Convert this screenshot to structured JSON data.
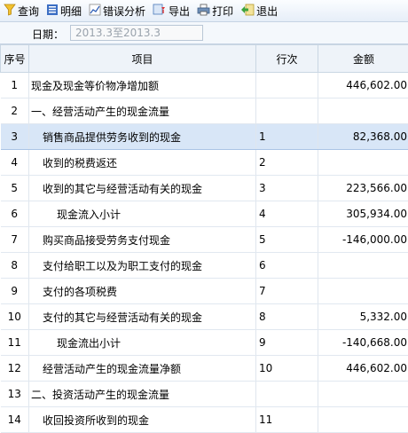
{
  "toolbar": {
    "query": "查询",
    "detail": "明细",
    "error_analysis": "错误分析",
    "export": "导出",
    "print": "打印",
    "exit": "退出"
  },
  "filter": {
    "date_label": "日期：",
    "date_value": "2013.3至2013.3"
  },
  "table": {
    "headers": [
      "序号",
      "项目",
      "行次",
      "金额"
    ],
    "rows": [
      {
        "no": "1",
        "item": "现金及现金等价物净增加额",
        "line": "",
        "amount": "446,602.00",
        "indent": 0
      },
      {
        "no": "2",
        "item": "一、经营活动产生的现金流量",
        "line": "",
        "amount": "",
        "indent": 0
      },
      {
        "no": "3",
        "item": "销售商品提供劳务收到的现金",
        "line": "1",
        "amount": "82,368.00",
        "indent": 1
      },
      {
        "no": "4",
        "item": "收到的税费返还",
        "line": "2",
        "amount": "",
        "indent": 1
      },
      {
        "no": "5",
        "item": "收到的其它与经营活动有关的现金",
        "line": "3",
        "amount": "223,566.00",
        "indent": 1
      },
      {
        "no": "6",
        "item": "现金流入小计",
        "line": "4",
        "amount": "305,934.00",
        "indent": 2
      },
      {
        "no": "7",
        "item": "购买商品接受劳务支付现金",
        "line": "5",
        "amount": "-146,000.00",
        "indent": 1
      },
      {
        "no": "8",
        "item": "支付给职工以及为职工支付的现金",
        "line": "6",
        "amount": "",
        "indent": 1
      },
      {
        "no": "9",
        "item": "支付的各项税费",
        "line": "7",
        "amount": "",
        "indent": 1
      },
      {
        "no": "10",
        "item": "支付的其它与经营活动有关的现金",
        "line": "8",
        "amount": "5,332.00",
        "indent": 1
      },
      {
        "no": "11",
        "item": "现金流出小计",
        "line": "9",
        "amount": "-140,668.00",
        "indent": 2
      },
      {
        "no": "12",
        "item": "经营活动产生的现金流量净额",
        "line": "10",
        "amount": "446,602.00",
        "indent": 1
      },
      {
        "no": "13",
        "item": "二、投资活动产生的现金流量",
        "line": "",
        "amount": "",
        "indent": 0
      },
      {
        "no": "14",
        "item": "收回投资所收到的现金",
        "line": "11",
        "amount": "",
        "indent": 1
      }
    ]
  },
  "colors": {
    "selected_row": "#d8e6f7",
    "header_bg": "#eef3f9"
  }
}
